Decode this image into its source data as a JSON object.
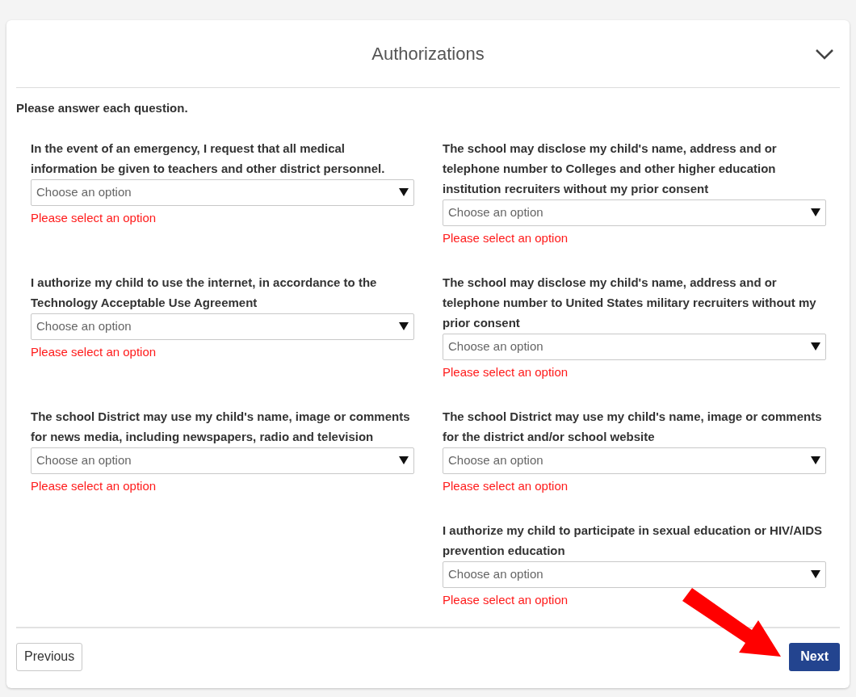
{
  "section": {
    "title": "Authorizations",
    "expanded": true
  },
  "instructions": "Please answer each question.",
  "rows": [
    {
      "left": {
        "label": "In the event of an emergency, I request that all medical information be given to teachers and other district personnel.",
        "placeholder": "Choose an option",
        "error": "Please select an option"
      },
      "right": {
        "label": "The school may disclose my child's name, address and or telephone number to Colleges and other higher education institution recruiters without my prior consent",
        "placeholder": "Choose an option",
        "error": "Please select an option"
      }
    },
    {
      "left": {
        "label": "I authorize my child to use the internet, in accordance to the Technology Acceptable Use Agreement",
        "placeholder": "Choose an option",
        "error": "Please select an option"
      },
      "right": {
        "label": "The school may disclose my child's name, address and or telephone number to United States military recruiters without my prior consent",
        "placeholder": "Choose an option",
        "error": "Please select an option"
      }
    },
    {
      "left": {
        "label": "The school District may use my child's name, image or comments for news media, including newspapers, radio and television",
        "placeholder": "Choose an option",
        "error": "Please select an option"
      },
      "right": {
        "label": "The school District may use my child's name, image or comments for the district and/or school website",
        "placeholder": "Choose an option",
        "error": "Please select an option"
      }
    },
    {
      "right": {
        "label": "I authorize my child to participate in sexual education or HIV/AIDS prevention education",
        "placeholder": "Choose an option",
        "error": "Please select an option"
      }
    }
  ],
  "buttons": {
    "previous": "Previous",
    "next": "Next"
  }
}
